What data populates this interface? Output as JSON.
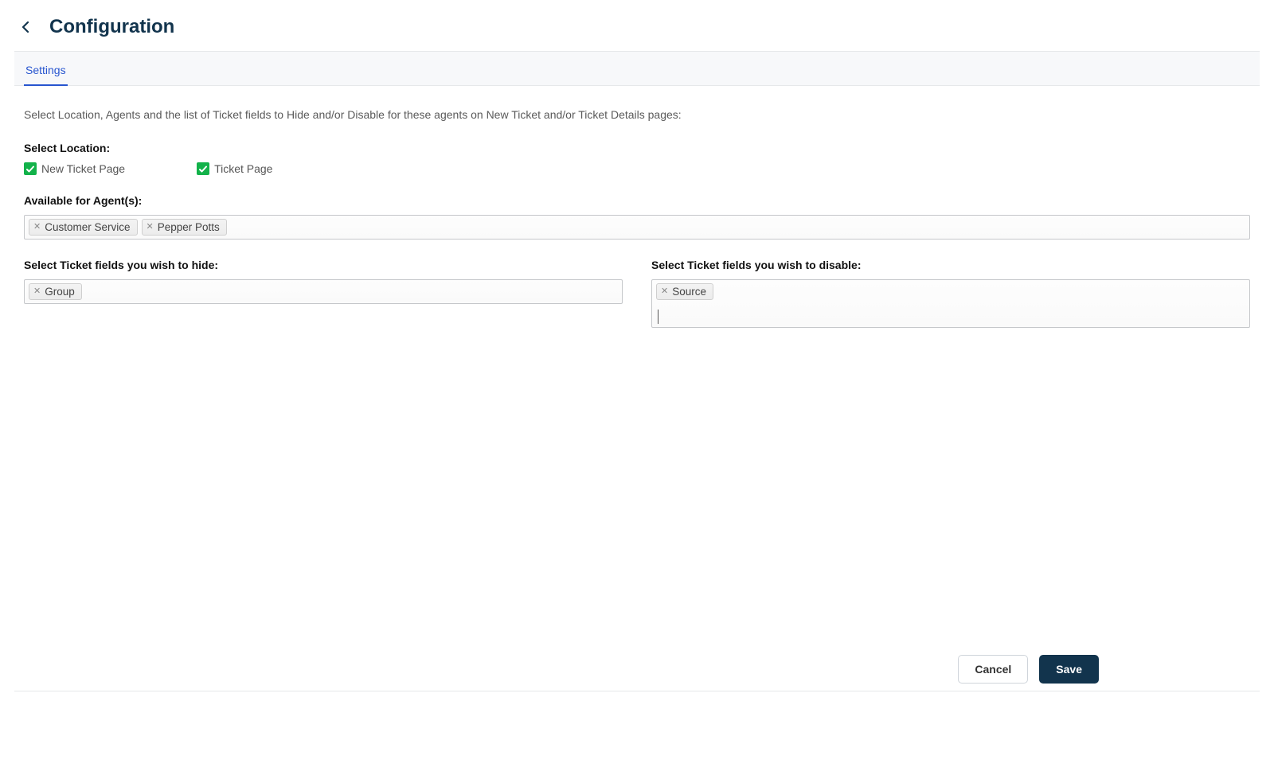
{
  "header": {
    "title": "Configuration"
  },
  "tabs": {
    "settings": "Settings"
  },
  "instruction": "Select Location, Agents and the list of Ticket fields to Hide and/or Disable for these agents on New Ticket and/or Ticket Details pages:",
  "location": {
    "label": "Select Location:",
    "new_ticket": {
      "checked": true,
      "label": "New Ticket Page"
    },
    "ticket": {
      "checked": true,
      "label": "Ticket Page"
    }
  },
  "agents": {
    "label": "Available for Agent(s):",
    "tags": [
      "Customer Service",
      "Pepper Potts"
    ]
  },
  "hide_fields": {
    "label": "Select Ticket fields you wish to hide:",
    "tags": [
      "Group"
    ]
  },
  "disable_fields": {
    "label": "Select Ticket fields you wish to disable:",
    "tags": [
      "Source"
    ]
  },
  "footer": {
    "cancel": "Cancel",
    "save": "Save"
  },
  "colors": {
    "primary_dark": "#12344d",
    "checkbox_green": "#13b24a",
    "tab_blue": "#2755cf"
  }
}
